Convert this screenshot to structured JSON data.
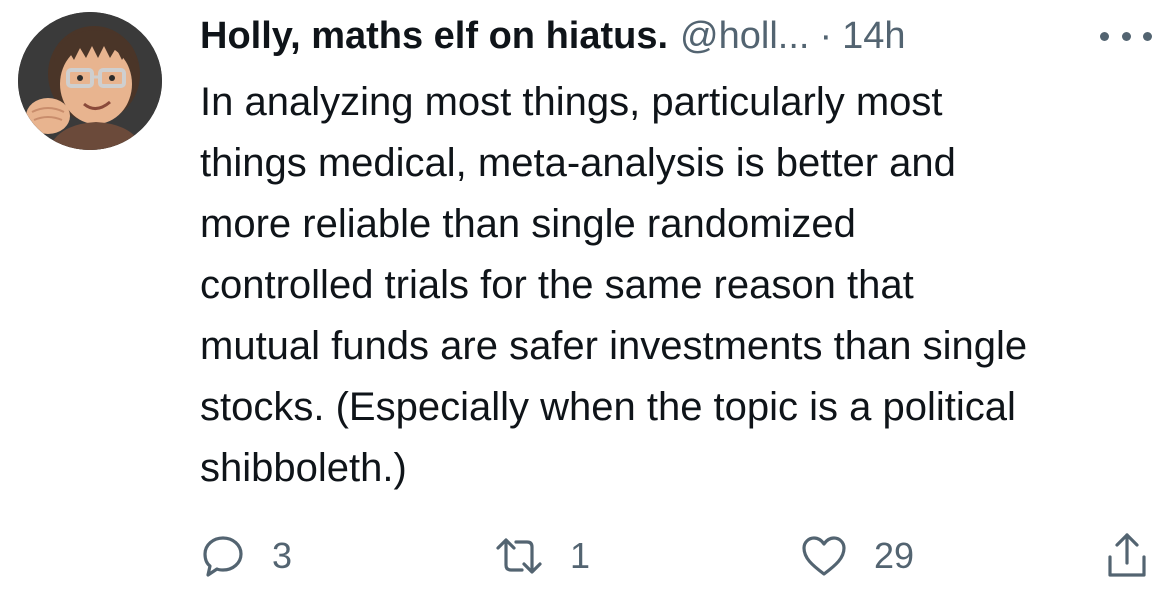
{
  "tweet": {
    "author_name": "Holly, maths elf on hiatus.",
    "handle": "@holl...",
    "separator": "·",
    "time": "14h",
    "text_lines": [
      "In analyzing most things, particularly most",
      "things medical, meta-analysis is better and",
      "more reliable than single randomized",
      "controlled trials for the same reason that",
      "mutual funds are safer investments than single",
      "stocks. (Especially when the topic is a political",
      "shibboleth.)"
    ],
    "actions": {
      "reply": {
        "icon": "reply-icon",
        "count": "3"
      },
      "retweet": {
        "icon": "retweet-icon",
        "count": "1"
      },
      "like": {
        "icon": "heart-icon",
        "count": "29"
      },
      "share": {
        "icon": "share-icon"
      }
    },
    "more_icon": "more-options-icon",
    "avatar_icon": "memoji-avatar"
  },
  "colors": {
    "text_primary": "#0f1419",
    "text_secondary": "#536471",
    "background": "#ffffff"
  }
}
